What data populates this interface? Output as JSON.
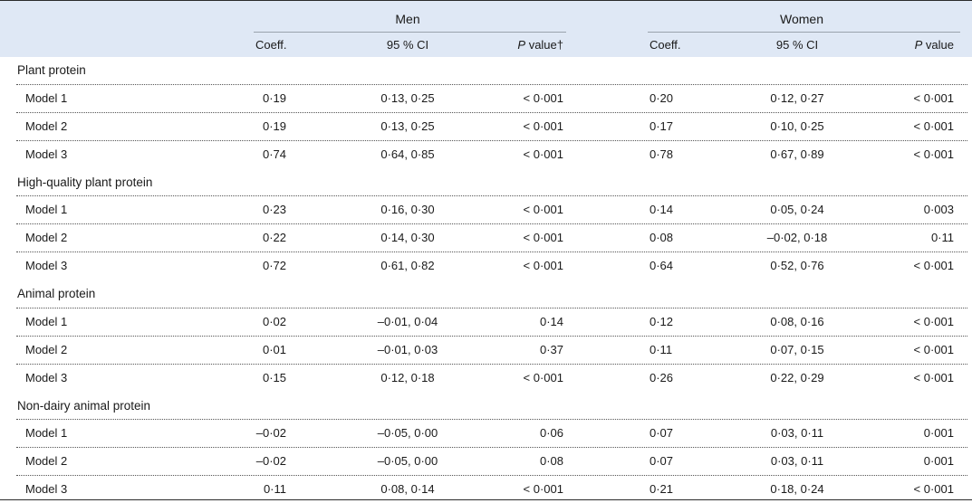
{
  "groups": {
    "men": "Men",
    "women": "Women"
  },
  "columns": {
    "coeff": "Coeff.",
    "ci": "95 % CI",
    "p_men_italic": "P",
    "p_men_rest": " value†",
    "p_women_italic": "P",
    "p_women_rest": " value"
  },
  "sections": [
    {
      "label": "Plant protein",
      "rows": [
        {
          "model": "Model 1",
          "men_coeff": "0·19",
          "men_ci": "0·13, 0·25",
          "men_p": "< 0·001",
          "women_coeff": "0·20",
          "women_ci": "0·12, 0·27",
          "women_p": "< 0·001"
        },
        {
          "model": "Model 2",
          "men_coeff": "0·19",
          "men_ci": "0·13, 0·25",
          "men_p": "< 0·001",
          "women_coeff": "0·17",
          "women_ci": "0·10, 0·25",
          "women_p": "< 0·001"
        },
        {
          "model": "Model 3",
          "men_coeff": "0·74",
          "men_ci": "0·64, 0·85",
          "men_p": "< 0·001",
          "women_coeff": "0·78",
          "women_ci": "0·67, 0·89",
          "women_p": "< 0·001"
        }
      ]
    },
    {
      "label": "High-quality plant protein",
      "rows": [
        {
          "model": "Model 1",
          "men_coeff": "0·23",
          "men_ci": "0·16, 0·30",
          "men_p": "< 0·001",
          "women_coeff": "0·14",
          "women_ci": "0·05, 0·24",
          "women_p": "0·003"
        },
        {
          "model": "Model 2",
          "men_coeff": "0·22",
          "men_ci": "0·14, 0·30",
          "men_p": "< 0·001",
          "women_coeff": "0·08",
          "women_ci": "–0·02, 0·18",
          "women_p": "0·11"
        },
        {
          "model": "Model 3",
          "men_coeff": "0·72",
          "men_ci": "0·61, 0·82",
          "men_p": "< 0·001",
          "women_coeff": "0·64",
          "women_ci": "0·52, 0·76",
          "women_p": "< 0·001"
        }
      ]
    },
    {
      "label": "Animal protein",
      "rows": [
        {
          "model": "Model 1",
          "men_coeff": "0·02",
          "men_ci": "–0·01, 0·04",
          "men_p": "0·14",
          "women_coeff": "0·12",
          "women_ci": "0·08, 0·16",
          "women_p": "< 0·001"
        },
        {
          "model": "Model 2",
          "men_coeff": "0·01",
          "men_ci": "–0·01, 0·03",
          "men_p": "0·37",
          "women_coeff": "0·11",
          "women_ci": "0·07, 0·15",
          "women_p": "< 0·001"
        },
        {
          "model": "Model 3",
          "men_coeff": "0·15",
          "men_ci": "0·12, 0·18",
          "men_p": "< 0·001",
          "women_coeff": "0·26",
          "women_ci": "0·22, 0·29",
          "women_p": "< 0·001"
        }
      ]
    },
    {
      "label": "Non-dairy animal protein",
      "rows": [
        {
          "model": "Model 1",
          "men_coeff": "–0·02",
          "men_ci": "–0·05, 0·00",
          "men_p": "0·06",
          "women_coeff": "0·07",
          "women_ci": "0·03, 0·11",
          "women_p": "0·001"
        },
        {
          "model": "Model 2",
          "men_coeff": "–0·02",
          "men_ci": "–0·05, 0·00",
          "men_p": "0·08",
          "women_coeff": "0·07",
          "women_ci": "0·03, 0·11",
          "women_p": "0·001"
        },
        {
          "model": "Model 3",
          "men_coeff": "0·11",
          "men_ci": "0·08, 0·14",
          "men_p": "< 0·001",
          "women_coeff": "0·21",
          "women_ci": "0·18, 0·24",
          "women_p": "< 0·001"
        }
      ]
    }
  ]
}
